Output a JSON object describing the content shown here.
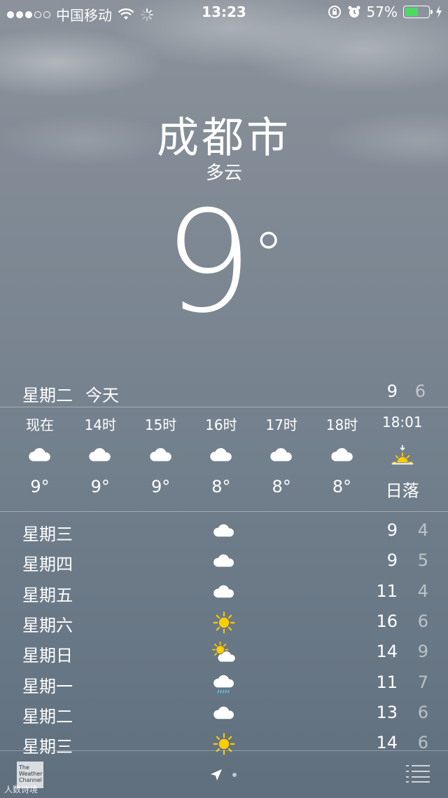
{
  "status_bar": {
    "carrier": "中国移动",
    "time": "13:23",
    "battery": "57%",
    "battery_level": 0.57,
    "signal_bars": 3
  },
  "location": {
    "city": "成都市",
    "condition": "多云",
    "temperature": "9",
    "degree_symbol": "°"
  },
  "today": {
    "day": "星期二",
    "label": "今天",
    "high": "9",
    "low": "6"
  },
  "hourly": [
    {
      "time": "现在",
      "icon": "cloud-icon",
      "value": "9°"
    },
    {
      "time": "14时",
      "icon": "cloud-icon",
      "value": "9°"
    },
    {
      "time": "15时",
      "icon": "cloud-icon",
      "value": "9°"
    },
    {
      "time": "16时",
      "icon": "cloud-icon",
      "value": "8°"
    },
    {
      "time": "17时",
      "icon": "cloud-icon",
      "value": "8°"
    },
    {
      "time": "18时",
      "icon": "cloud-icon",
      "value": "8°"
    },
    {
      "time": "18:01",
      "icon": "sunset-icon",
      "value": "日落"
    }
  ],
  "daily": [
    {
      "day": "星期三",
      "icon": "cloud-icon",
      "high": "9",
      "low": "4"
    },
    {
      "day": "星期四",
      "icon": "cloud-icon",
      "high": "9",
      "low": "5"
    },
    {
      "day": "星期五",
      "icon": "cloud-icon",
      "high": "11",
      "low": "4"
    },
    {
      "day": "星期六",
      "icon": "sun-icon",
      "high": "16",
      "low": "6"
    },
    {
      "day": "星期日",
      "icon": "partly-cloudy-icon",
      "high": "14",
      "low": "9"
    },
    {
      "day": "星期一",
      "icon": "rain-icon",
      "high": "11",
      "low": "7"
    },
    {
      "day": "星期二",
      "icon": "cloud-icon",
      "high": "13",
      "low": "6"
    },
    {
      "day": "星期三",
      "icon": "sun-icon",
      "high": "14",
      "low": "6"
    }
  ],
  "footer": {
    "logo_text": "The Weather Channel",
    "watermark": "人数诗境",
    "page_count": 1
  },
  "colors": {
    "sun": "#ffcc00",
    "battery_fill": "#4cd964",
    "rain": "#5ac8fa"
  }
}
